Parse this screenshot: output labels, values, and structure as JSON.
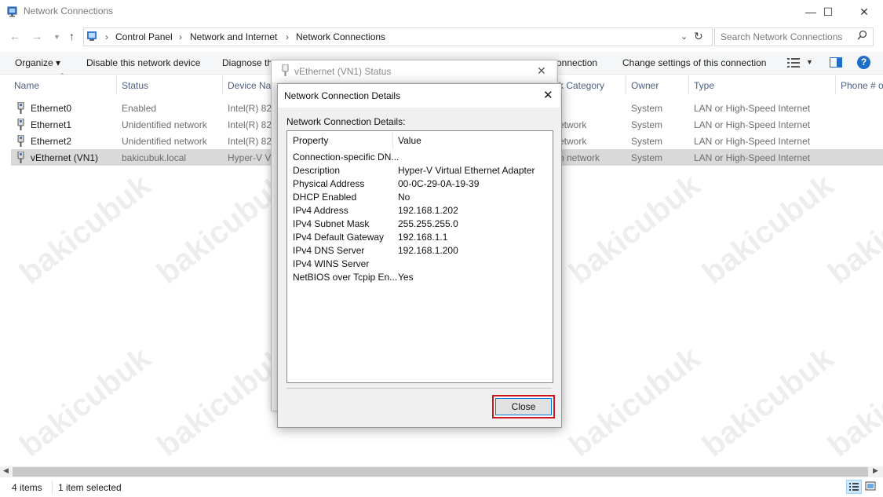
{
  "window": {
    "title": "Network Connections",
    "minimize": "—",
    "maximize": "☐",
    "close": "✕"
  },
  "address": {
    "crumbs": [
      "Control Panel",
      "Network and Internet",
      "Network Connections"
    ],
    "sep": "›",
    "search_placeholder": "Search Network Connections"
  },
  "toolbar": {
    "organize": "Organize ▾",
    "disable": "Disable this network device",
    "diagnose": "Diagnose th",
    "connection_tail": "onnection",
    "change_settings": "Change settings of this connection"
  },
  "columns": {
    "name": "Name",
    "status": "Status",
    "device": "Device Nar",
    "category": "k Category",
    "owner": "Owner",
    "type": "Type",
    "phone": "Phone # o"
  },
  "rows": [
    {
      "name": "Ethernet0",
      "status": "Enabled",
      "device": "Intel(R) 825",
      "category": "",
      "owner": "System",
      "type": "LAN or High-Speed Internet"
    },
    {
      "name": "Ethernet1",
      "status": "Unidentified network",
      "device": "Intel(R) 825",
      "category": "etwork",
      "owner": "System",
      "type": "LAN or High-Speed Internet"
    },
    {
      "name": "Ethernet2",
      "status": "Unidentified network",
      "device": "Intel(R) 825",
      "category": "etwork",
      "owner": "System",
      "type": "LAN or High-Speed Internet"
    },
    {
      "name": "vEthernet (VN1)",
      "status": "bakicubuk.local",
      "device": "Hyper-V Virt",
      "category": "n network",
      "owner": "System",
      "type": "LAN or High-Speed Internet"
    }
  ],
  "statusbar": {
    "items": "4 items",
    "selected": "1 item selected"
  },
  "status_dialog": {
    "title": "vEthernet (VN1) Status",
    "close": "✕"
  },
  "details_dialog": {
    "title": "Network Connection Details",
    "close": "✕",
    "label": "Network Connection Details:",
    "header_property": "Property",
    "header_value": "Value",
    "properties": [
      {
        "property": "Connection-specific DN...",
        "value": ""
      },
      {
        "property": "Description",
        "value": "Hyper-V Virtual Ethernet Adapter"
      },
      {
        "property": "Physical Address",
        "value": "00-0C-29-0A-19-39"
      },
      {
        "property": "DHCP Enabled",
        "value": "No"
      },
      {
        "property": "IPv4 Address",
        "value": "192.168.1.202"
      },
      {
        "property": "IPv4 Subnet Mask",
        "value": "255.255.255.0"
      },
      {
        "property": "IPv4 Default Gateway",
        "value": "192.168.1.1"
      },
      {
        "property": "IPv4 DNS Server",
        "value": "192.168.1.200"
      },
      {
        "property": "IPv4 WINS Server",
        "value": ""
      },
      {
        "property": "NetBIOS over Tcpip En...",
        "value": "Yes"
      }
    ],
    "close_button": "Close"
  },
  "watermark": "bakicubuk",
  "colors": {
    "highlight": "#cce8ff",
    "selected_row": "#d9d9d9",
    "close_border": "#d0141d",
    "help": "#1e6fc8"
  }
}
